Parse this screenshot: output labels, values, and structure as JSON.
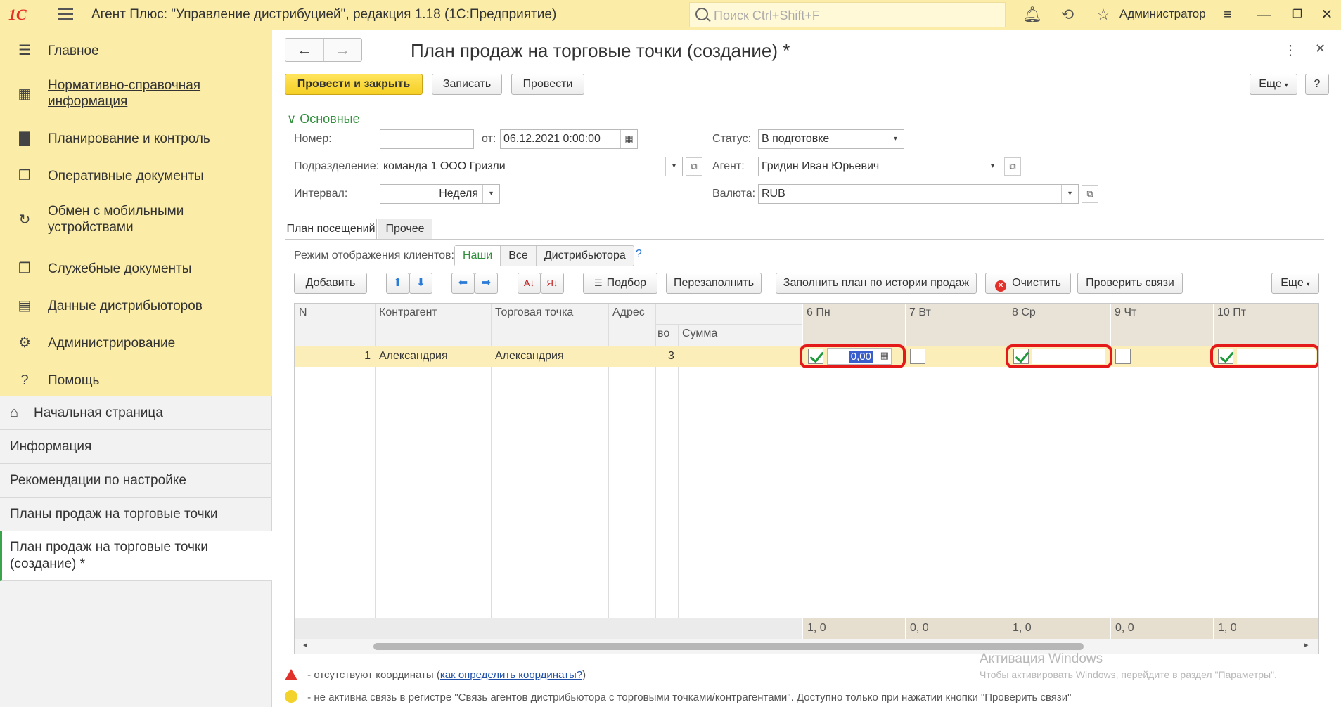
{
  "app": {
    "logo_text": "1С",
    "title": "Агент Плюс: \"Управление дистрибуцией\", редакция 1.18  (1С:Предприятие)",
    "search_placeholder": "Поиск Ctrl+Shift+F",
    "user": "Администратор"
  },
  "sidebar": {
    "sections": [
      {
        "label": "Главное",
        "icon": "list-icon"
      },
      {
        "label": "Нормативно-справочная информация",
        "icon": "catalog-icon"
      },
      {
        "label": "Планирование и контроль",
        "icon": "chart-icon"
      },
      {
        "label": "Оперативные документы",
        "icon": "documents-icon"
      },
      {
        "label": "Обмен с мобильными устройствами",
        "icon": "sync-icon"
      },
      {
        "label": "Служебные документы",
        "icon": "service-docs-icon"
      },
      {
        "label": "Данные дистрибьюторов",
        "icon": "distributor-data-icon"
      },
      {
        "label": "Администрирование",
        "icon": "gear-icon"
      },
      {
        "label": "Помощь",
        "icon": "help-icon"
      }
    ],
    "open_windows": [
      {
        "label": "Начальная страница"
      },
      {
        "label": "Информация"
      },
      {
        "label": "Рекомендации по настройке"
      },
      {
        "label": "Планы продаж на торговые точки"
      },
      {
        "label": "План продаж на торговые точки (создание) *"
      }
    ]
  },
  "form": {
    "title": "План продаж на торговые точки (создание) *",
    "toolbar": {
      "post_close": "Провести и закрыть",
      "save": "Записать",
      "post": "Провести",
      "more": "Еще",
      "help": "?"
    },
    "group_title": "Основные",
    "fields": {
      "number_label": "Номер:",
      "number_value": "",
      "date_label": "от:",
      "date_value": "06.12.2021  0:00:00",
      "status_label": "Статус:",
      "status_value": "В подготовке",
      "division_label": "Подразделение:",
      "division_value": "команда 1 ООО Гризли",
      "agent_label": "Агент:",
      "agent_value": "Гридин Иван Юрьевич",
      "interval_label": "Интервал:",
      "interval_value": "Неделя",
      "currency_label": "Валюта:",
      "currency_value": "RUB"
    },
    "tabs": [
      "План посещений",
      "Прочее"
    ],
    "display_mode": {
      "label": "Режим отображения клиентов:",
      "options": [
        "Наши",
        "Все",
        "Дистрибьютора"
      ],
      "selected": "Наши",
      "help": "?"
    },
    "table_toolbar": {
      "add": "Добавить",
      "pick": "Подбор",
      "refill": "Перезаполнить",
      "fill_history": "Заполнить план по истории продаж",
      "clear": "Очистить",
      "check_links": "Проверить связи",
      "more": "Еще"
    },
    "table": {
      "columns": [
        "N",
        "Контрагент",
        "Торговая точка",
        "Адрес",
        "во",
        "Сумма"
      ],
      "days": [
        "6 Пн",
        "7 Вт",
        "8 Ср",
        "9 Чт",
        "10 Пт"
      ],
      "rows": [
        {
          "n": "1",
          "counterparty": "Александрия",
          "outlet": "Александрия",
          "address": "",
          "qty": "3",
          "sum": "",
          "days": [
            true,
            false,
            true,
            false,
            true
          ],
          "editing_value": "0,00"
        }
      ],
      "footer": [
        "1, 0",
        "0, 0",
        "1, 0",
        "0, 0",
        "1, 0"
      ]
    },
    "notes": {
      "no_coords": " - отсутствуют координаты (",
      "no_coords_link": "как определить координаты?",
      "no_coords_end": ")",
      "inactive_link": " - не активна связь в регистре \"Связь агентов дистрибьютора с торговыми точками/контрагентами\". Доступно только при нажатии кнопки \"Проверить связи\""
    },
    "watermark": {
      "title": "Активация Windows",
      "subtitle": "Чтобы активировать Windows, перейдите в раздел \"Параметры\"."
    }
  },
  "colors": {
    "accent_yellow": "#fbeda7",
    "primary_button": "#f5cf24",
    "green": "#2f8f3a",
    "highlight_red": "#e41a1a"
  }
}
